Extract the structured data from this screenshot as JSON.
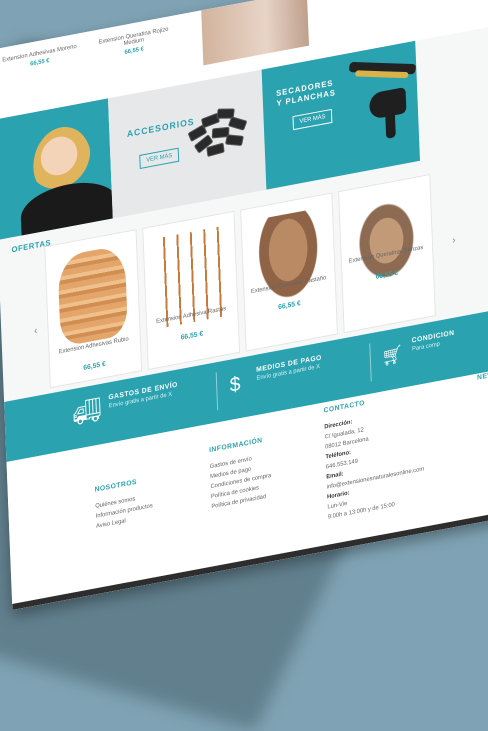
{
  "top_products": [
    {
      "name": "Extension Adhesivas Moreno",
      "price": "66,55 €"
    },
    {
      "name": "Extension Queratina Rojizo Medium",
      "price": "66,55 €"
    }
  ],
  "banners": {
    "accesorios": {
      "title": "ACCESORIOS",
      "button": "VER MÁS"
    },
    "secadores": {
      "title_line1": "SECADORES",
      "title_line2": "Y PLANCHAS",
      "button": "VER MÁS"
    }
  },
  "ofertas": {
    "title": "OFERTAS",
    "prev_arrow": "‹",
    "next_arrow": "›",
    "products": [
      {
        "name": "Extension Adhesivas Rubio",
        "price": "66,55 €"
      },
      {
        "name": "Extension Adhesiva Rastas",
        "price": "66,55 €"
      },
      {
        "name": "Extension Queratina Castaño",
        "price": "66,55 €"
      },
      {
        "name": "Extension Queratina Trenzas",
        "price": "66,55 €"
      }
    ]
  },
  "features": [
    {
      "icon": "truck-icon",
      "title": "GASTOS DE ENVÍO",
      "sub": "Envío gratis a partir de X"
    },
    {
      "icon": "money-hand-icon",
      "title": "MEDIOS DE PAGO",
      "sub": "Envío gratis a partir de X"
    },
    {
      "icon": "cart-icon",
      "title": "CONDICION",
      "sub": "Para comp"
    }
  ],
  "footer": {
    "nosotros": {
      "title": "NOSOTROS",
      "links": [
        "Quiénes somos",
        "Información productos",
        "Aviso Legal"
      ]
    },
    "informacion": {
      "title": "INFORMACIÓN",
      "links": [
        "Gastos de envío",
        "Medios de pago",
        "Condiciones de compra",
        "Política de cookies",
        "Política de privacidad"
      ]
    },
    "contacto": {
      "title": "CONTACTO",
      "direccion_label": "Dirección:",
      "direccion": "C/ Igualada, 12",
      "direccion2": "08012 Barcelona",
      "telefono_label": "Teléfono:",
      "telefono": "646.553.149",
      "email_label": "Email:",
      "email": "info@extensionesnaturalesonline.com",
      "horario_label": "Horario:",
      "horario": "Lun-Vie",
      "horario2": "9:00h a 13:00h y de 15:00"
    },
    "news": {
      "title": "NEWS"
    }
  },
  "colors": {
    "accent": "#2aa2b0",
    "background": "#7fa3b4"
  }
}
